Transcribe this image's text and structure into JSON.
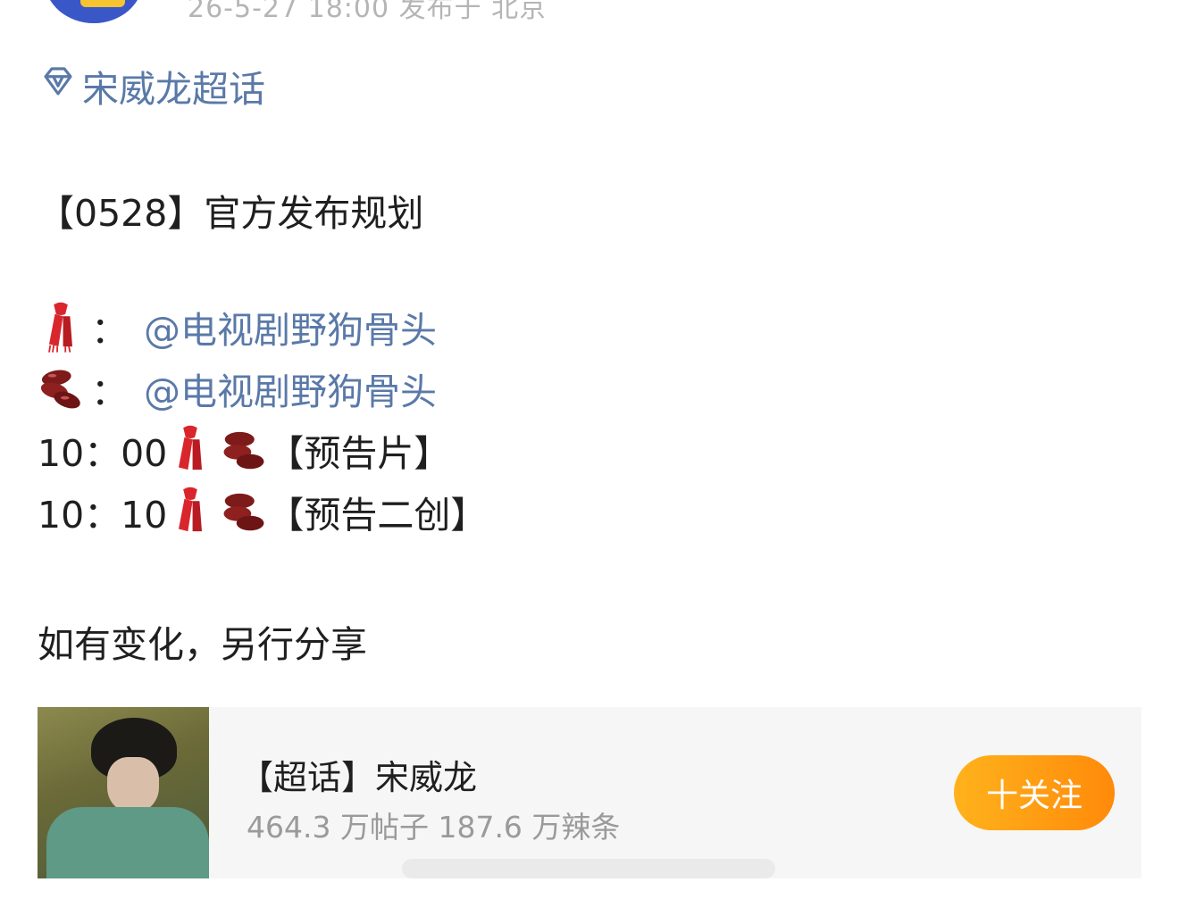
{
  "post": {
    "meta": "26-5-27 18:00  发布于 北京",
    "topic": "宋威龙超话",
    "headline": "【0528】官方发布规划",
    "mentions": [
      {
        "icon": "scarf-emoji",
        "colon": "：",
        "handle": "@电视剧野狗骨头"
      },
      {
        "icon": "beans-emoji",
        "colon": "：",
        "handle": "@电视剧野狗骨头"
      }
    ],
    "schedule": [
      {
        "time": "10：00",
        "label": "【预告片】"
      },
      {
        "time": "10：10",
        "label": "【预告二创】"
      }
    ],
    "footer": "如有变化，另行分享"
  },
  "card": {
    "title": "【超话】宋威龙",
    "stats": "464.3 万帖子 187.6 万辣条",
    "follow_label": "十关注"
  },
  "colors": {
    "link": "#5a79a8",
    "follow_gradient_start": "#ffb21c",
    "follow_gradient_end": "#ff8a0a"
  }
}
